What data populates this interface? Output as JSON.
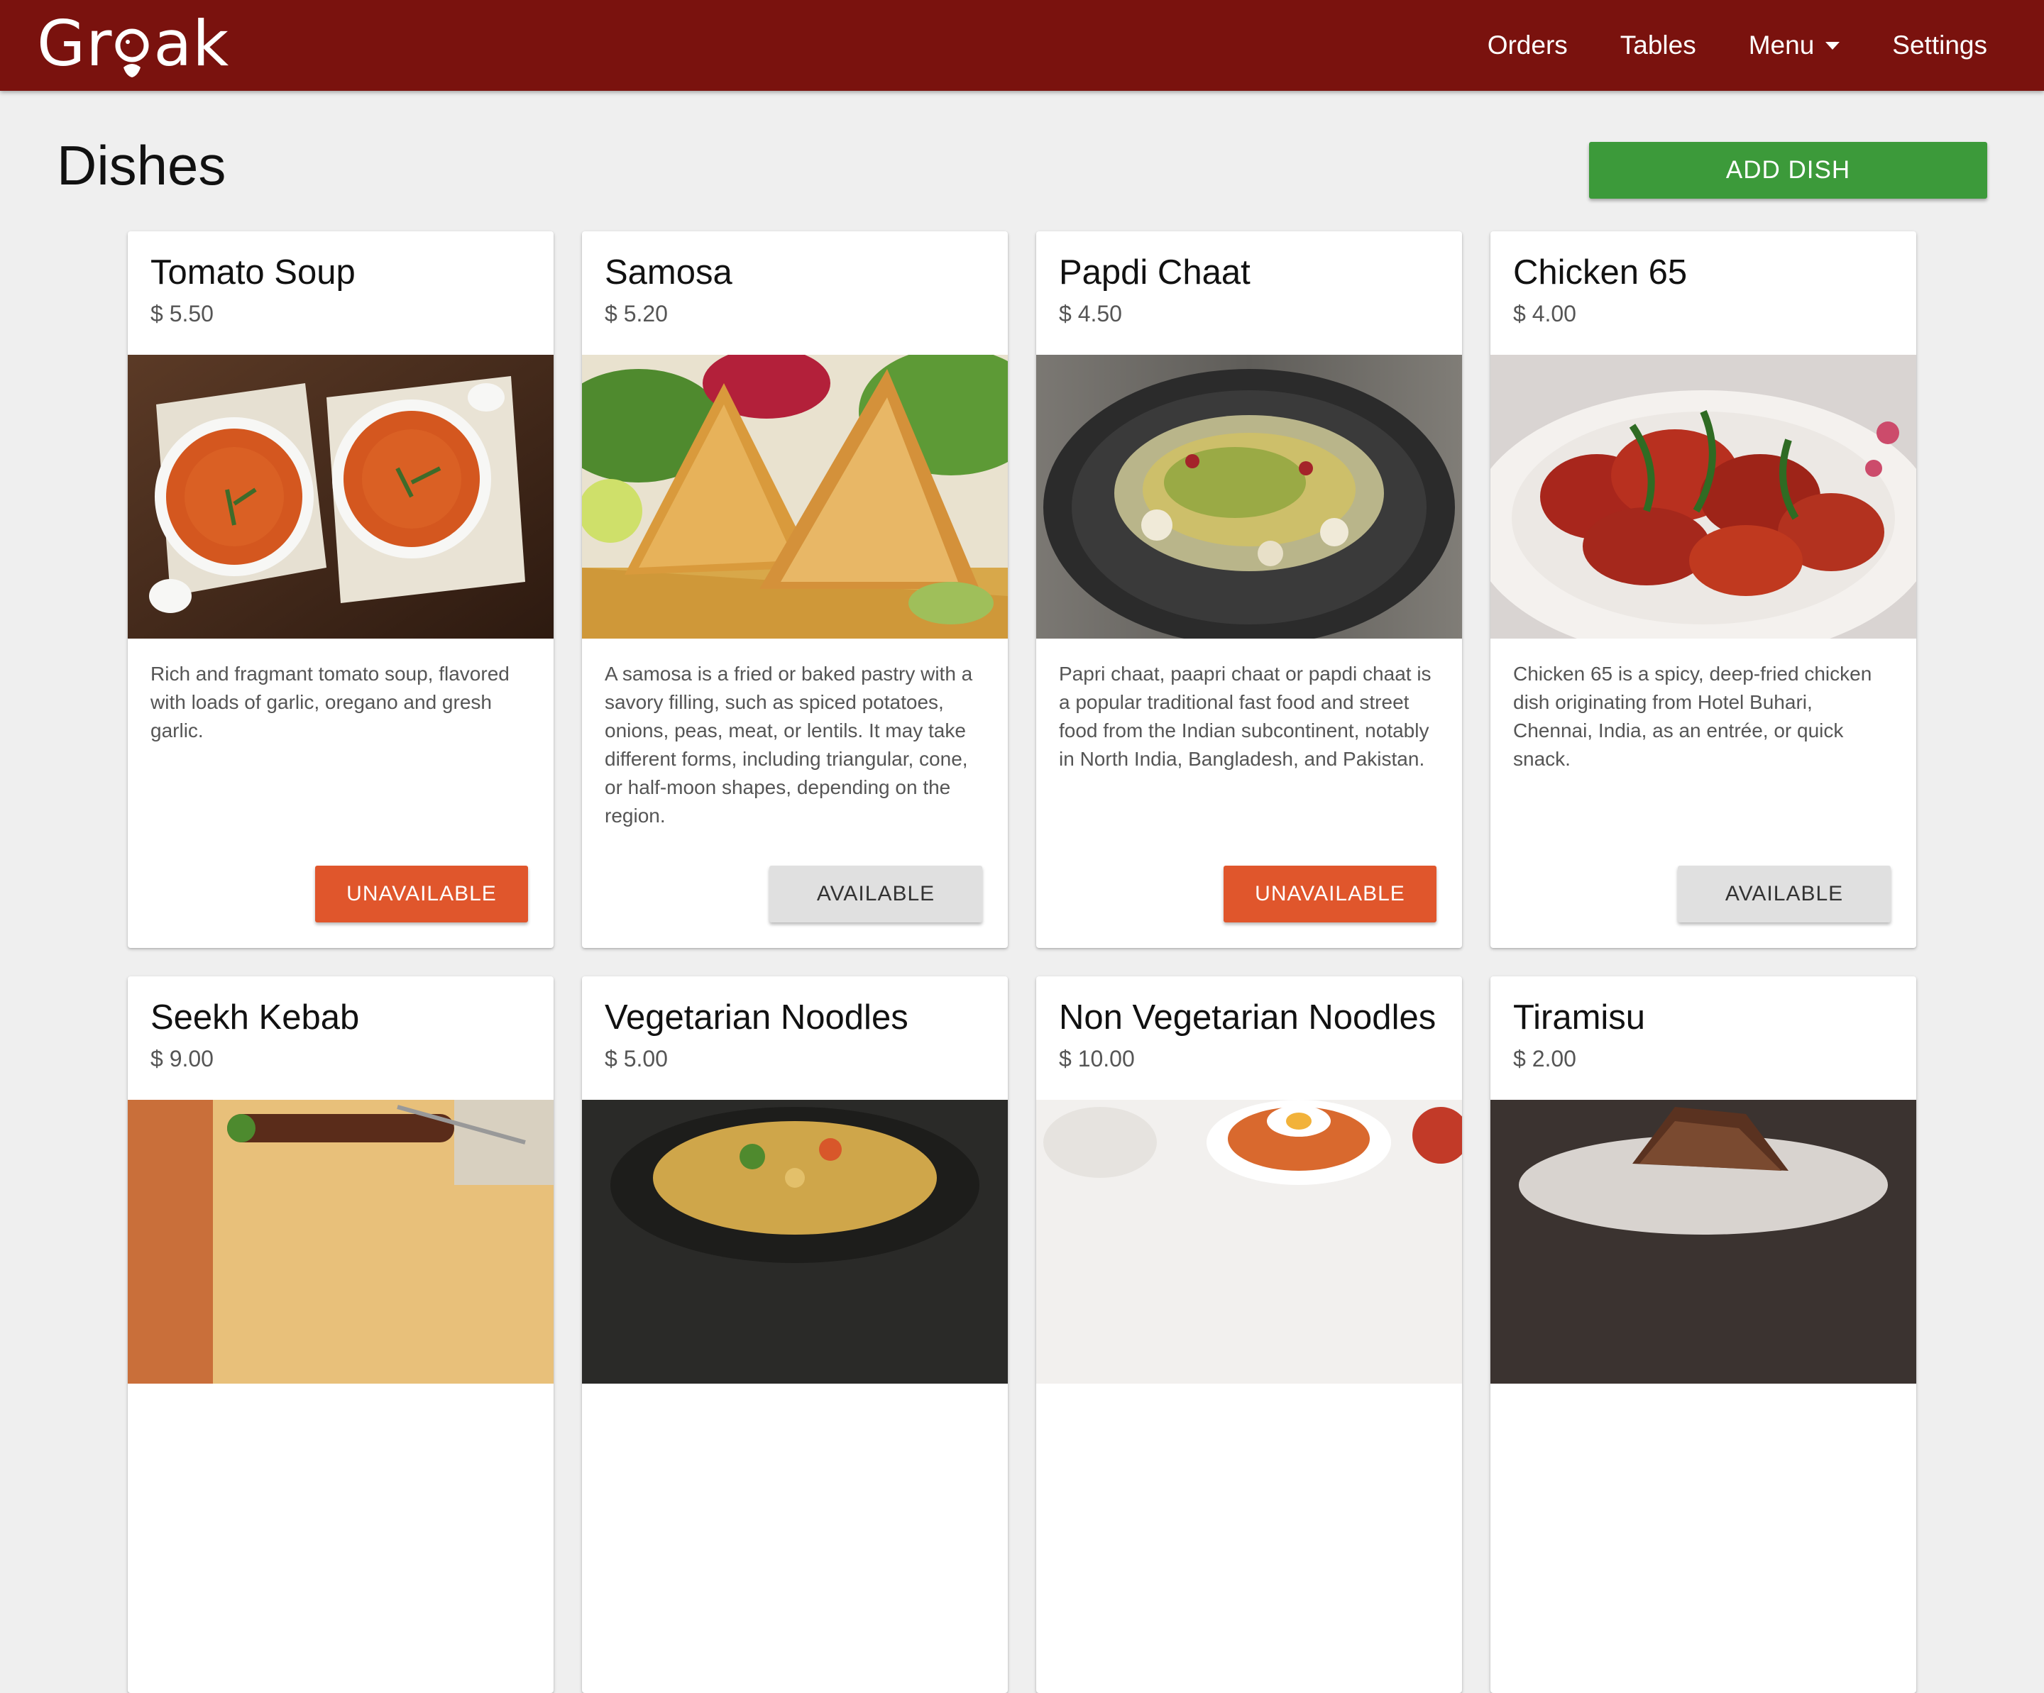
{
  "app": {
    "logo_text_left": "Gr",
    "logo_text_right": "ak",
    "brand_color": "#7a120e"
  },
  "nav": {
    "items": [
      {
        "label": "Orders"
      },
      {
        "label": "Tables"
      },
      {
        "label": "Menu",
        "has_dropdown": true
      },
      {
        "label": "Settings"
      }
    ]
  },
  "page": {
    "title": "Dishes",
    "add_button_label": "ADD DISH",
    "add_button_color": "#3c9a3a"
  },
  "dishes": [
    {
      "name": "Tomato Soup",
      "price": "$ 5.50",
      "description": "Rich and fragmant tomato soup, flavored with loads of garlic, oregano and gresh garlic.",
      "status_label": "UNAVAILABLE",
      "status": "unavailable",
      "image": "tomato-soup-photo"
    },
    {
      "name": "Samosa",
      "price": "$ 5.20",
      "description": "A samosa is a fried or baked pastry with a savory filling, such as spiced potatoes, onions, peas, meat, or lentils. It may take different forms, including triangular, cone, or half-moon shapes, depending on the region.",
      "status_label": "AVAILABLE",
      "status": "available",
      "image": "samosa-photo"
    },
    {
      "name": "Papdi Chaat",
      "price": "$ 4.50",
      "description": "Papri chaat, paapri chaat or papdi chaat is a popular traditional fast food and street food from the Indian subcontinent, notably in North India, Bangladesh, and Pakistan.",
      "status_label": "UNAVAILABLE",
      "status": "unavailable",
      "image": "papdi-chaat-photo"
    },
    {
      "name": "Chicken 65",
      "price": "$ 4.00",
      "description": "Chicken 65 is a spicy, deep-fried chicken dish originating from Hotel Buhari, Chennai, India, as an entrée, or quick snack.",
      "status_label": "AVAILABLE",
      "status": "available",
      "image": "chicken-65-photo"
    },
    {
      "name": "Seekh Kebab",
      "price": "$ 9.00",
      "image": "seekh-kebab-photo"
    },
    {
      "name": "Vegetarian Noodles",
      "price": "$ 5.00",
      "image": "vegetarian-noodles-photo"
    },
    {
      "name": "Non Vegetarian Noodles",
      "price": "$ 10.00",
      "image": "non-vegetarian-noodles-photo"
    },
    {
      "name": "Tiramisu",
      "price": "$ 2.00",
      "image": "tiramisu-photo"
    }
  ],
  "colors": {
    "unavailable": "#e0562c",
    "available": "#e0e0e0"
  }
}
